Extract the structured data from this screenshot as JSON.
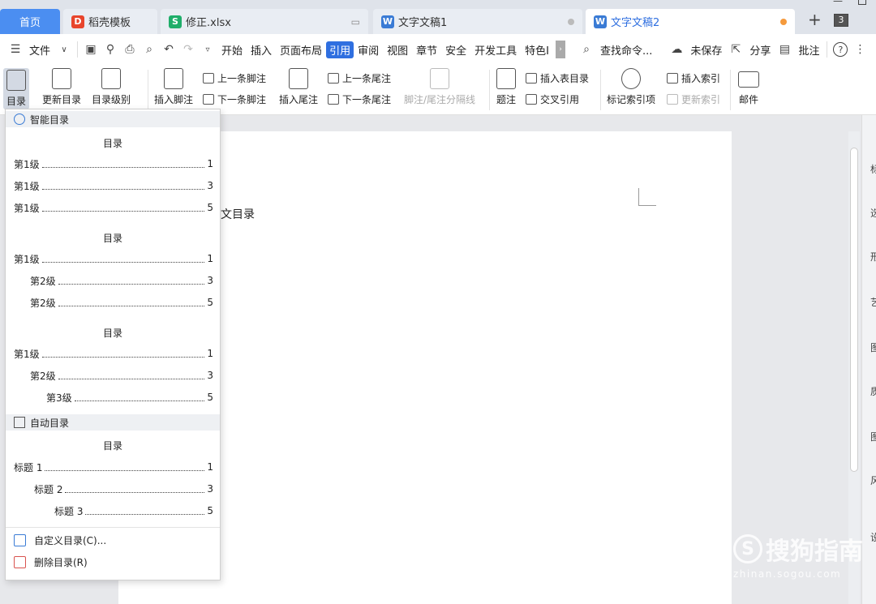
{
  "tabs": [
    {
      "label": "首页"
    },
    {
      "label": "稻壳模板",
      "icon": "D",
      "color": "#e8452c"
    },
    {
      "label": "修正.xlsx",
      "icon": "S",
      "color": "#1fae6a"
    },
    {
      "label": "文字文稿1",
      "icon": "W",
      "color": "#3a7bd5"
    },
    {
      "label": "文字文稿2",
      "icon": "W",
      "color": "#3a7bd5"
    }
  ],
  "tab_count": "3",
  "menu": {
    "file": "文件",
    "items": [
      "开始",
      "插入",
      "页面布局",
      "引用",
      "审阅",
      "视图",
      "章节",
      "安全",
      "开发工具",
      "特色I"
    ],
    "active_index": 3,
    "search": "查找命令...",
    "unsaved": "未保存",
    "share": "分享",
    "review": "批注",
    "help": "?"
  },
  "ribbon": {
    "toc": "目录",
    "update_toc": "更新目录",
    "toc_level": "目录级别",
    "insert_footnote": "插入脚注",
    "prev_footnote": "上一条脚注",
    "next_footnote": "下一条脚注",
    "insert_endnote": "插入尾注",
    "prev_endnote": "上一条尾注",
    "next_endnote": "下一条尾注",
    "separator": "脚注/尾注分隔线",
    "caption": "题注",
    "insert_table_toc": "插入表目录",
    "cross_ref": "交叉引用",
    "mark_index": "标记索引项",
    "insert_index": "插入索引",
    "update_index": "更新索引",
    "mail": "邮件"
  },
  "dropdown": {
    "smart_section": "智能目录",
    "auto_section": "自动目录",
    "toc_title": "目录",
    "group1": [
      {
        "label": "第1级",
        "page": "1"
      },
      {
        "label": "第1级",
        "page": "3"
      },
      {
        "label": "第1级",
        "page": "5"
      }
    ],
    "group2": [
      {
        "label": "第1级",
        "page": "1"
      },
      {
        "label": "第2级",
        "page": "3"
      },
      {
        "label": "第2级",
        "page": "5"
      }
    ],
    "group3": [
      {
        "label": "第1级",
        "page": "1"
      },
      {
        "label": "第2级",
        "page": "3"
      },
      {
        "label": "第3级",
        "page": "5"
      }
    ],
    "group4": [
      {
        "label": "标题 1",
        "page": "1"
      },
      {
        "label": "标题 2",
        "page": "3"
      },
      {
        "label": "标题 3",
        "page": "5"
      }
    ],
    "custom": "自定义目录(C)...",
    "delete": "删除目录(R)"
  },
  "document": {
    "visible_text": "文目录"
  },
  "right_panel": [
    "标",
    "选",
    "形",
    "艺",
    "图",
    "质",
    "图",
    "风",
    "设"
  ],
  "watermark": {
    "brand": "搜狗指南",
    "url": "zhinan.sogou.com"
  }
}
